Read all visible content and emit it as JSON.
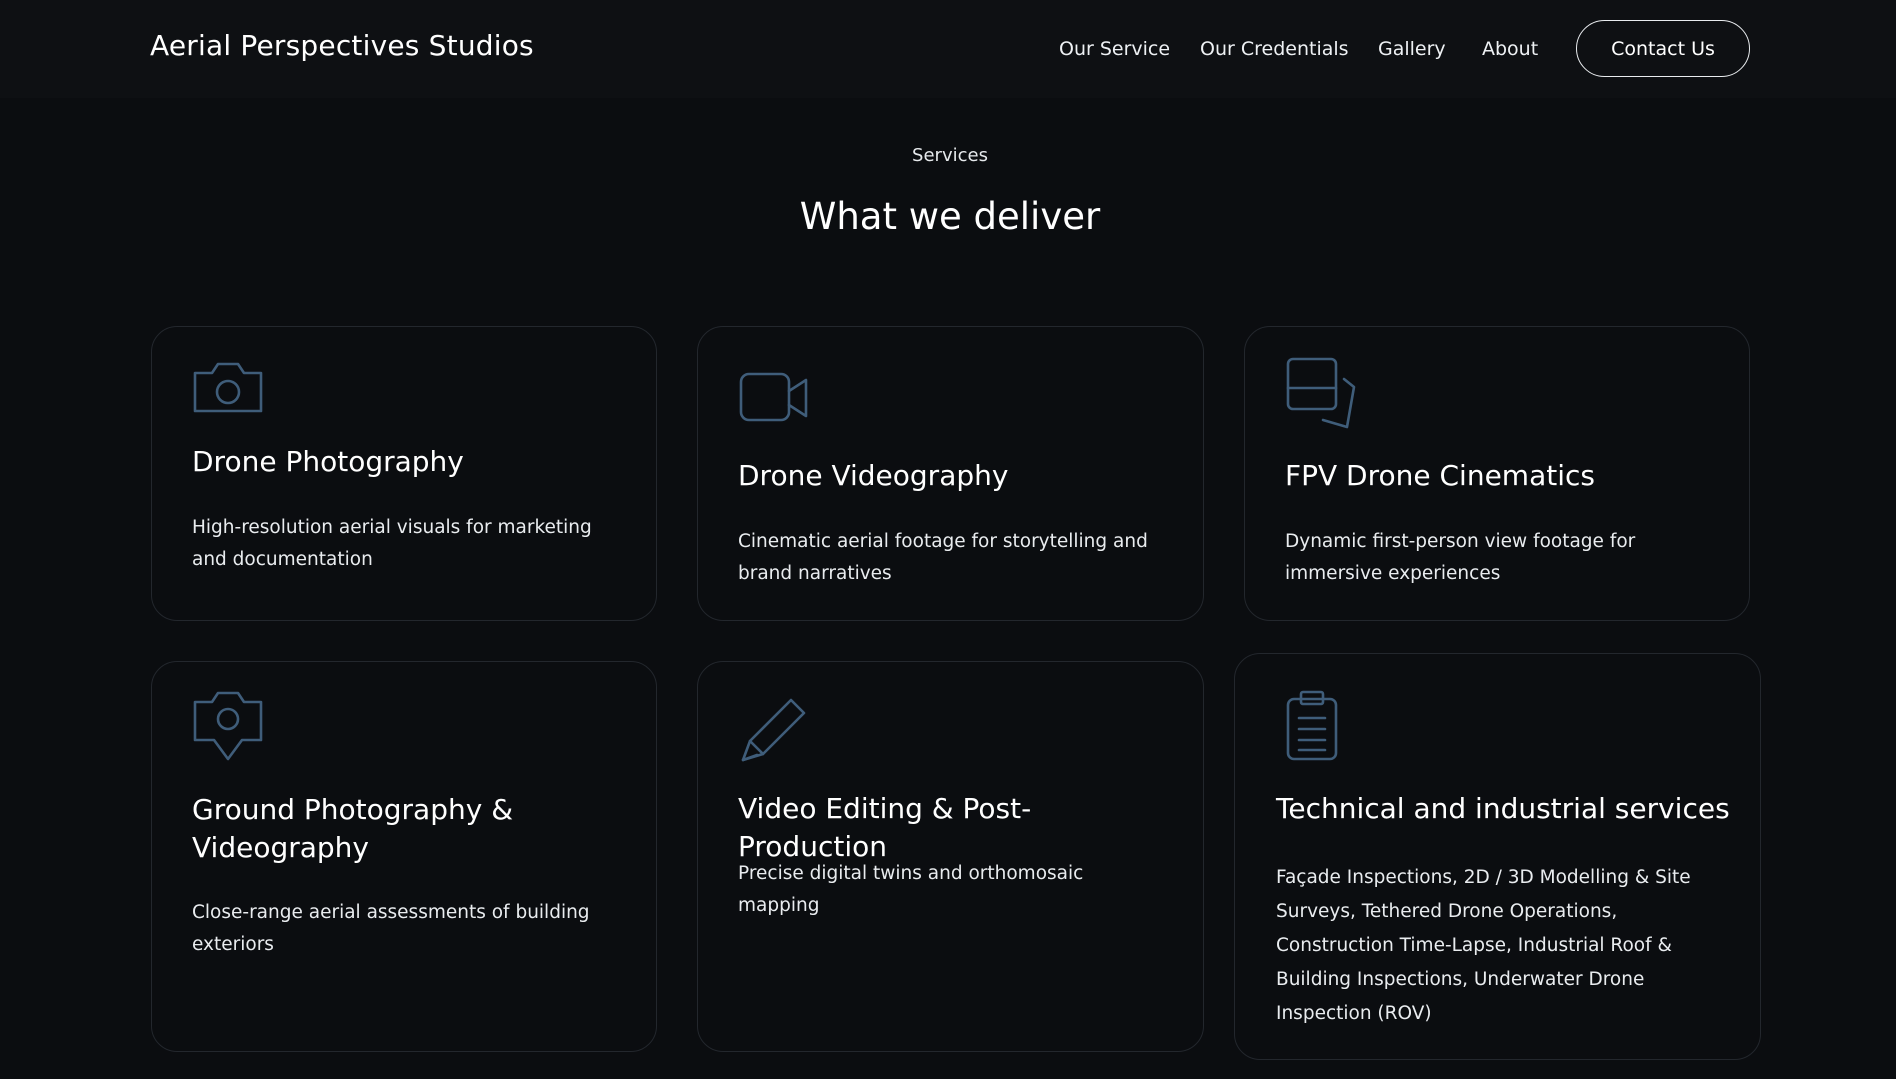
{
  "header": {
    "brand": "Aerial Perspectives Studios",
    "nav": [
      {
        "label": "Our Service"
      },
      {
        "label": "Our Credentials"
      },
      {
        "label": "Gallery"
      },
      {
        "label": "About"
      }
    ],
    "contact_label": "Contact Us"
  },
  "section": {
    "eyebrow": "Services",
    "title": "What we deliver"
  },
  "cards": [
    {
      "icon": "camera-icon",
      "title": "Drone Photography",
      "description": "High-resolution aerial visuals for marketing and documentation"
    },
    {
      "icon": "video-camera-icon",
      "title": "Drone Videography",
      "description": "Cinematic aerial footage for storytelling and brand narratives"
    },
    {
      "icon": "device-stack-icon",
      "title": "FPV Drone Cinematics",
      "description": "Dynamic first-person view footage for immersive experiences"
    },
    {
      "icon": "location-camera-icon",
      "title": "Ground Photography & Videography",
      "description": "Close-range aerial assessments of building exteriors"
    },
    {
      "icon": "pencil-icon",
      "title": "Video Editing & Post-Production",
      "description": "Precise digital twins and orthomosaic mapping"
    },
    {
      "icon": "clipboard-icon",
      "title": "Technical and industrial services",
      "description": "Façade Inspections, 2D / 3D Modelling & Site Surveys, Tethered Drone Operations, Construction Time-Lapse, Industrial Roof & Building Inspections, Underwater Drone Inspection (ROV)"
    }
  ],
  "colors": {
    "background": "#0b0d10",
    "card_border": "#23272d",
    "icon_stroke": "#3f5d7a",
    "text": "#ffffff"
  }
}
